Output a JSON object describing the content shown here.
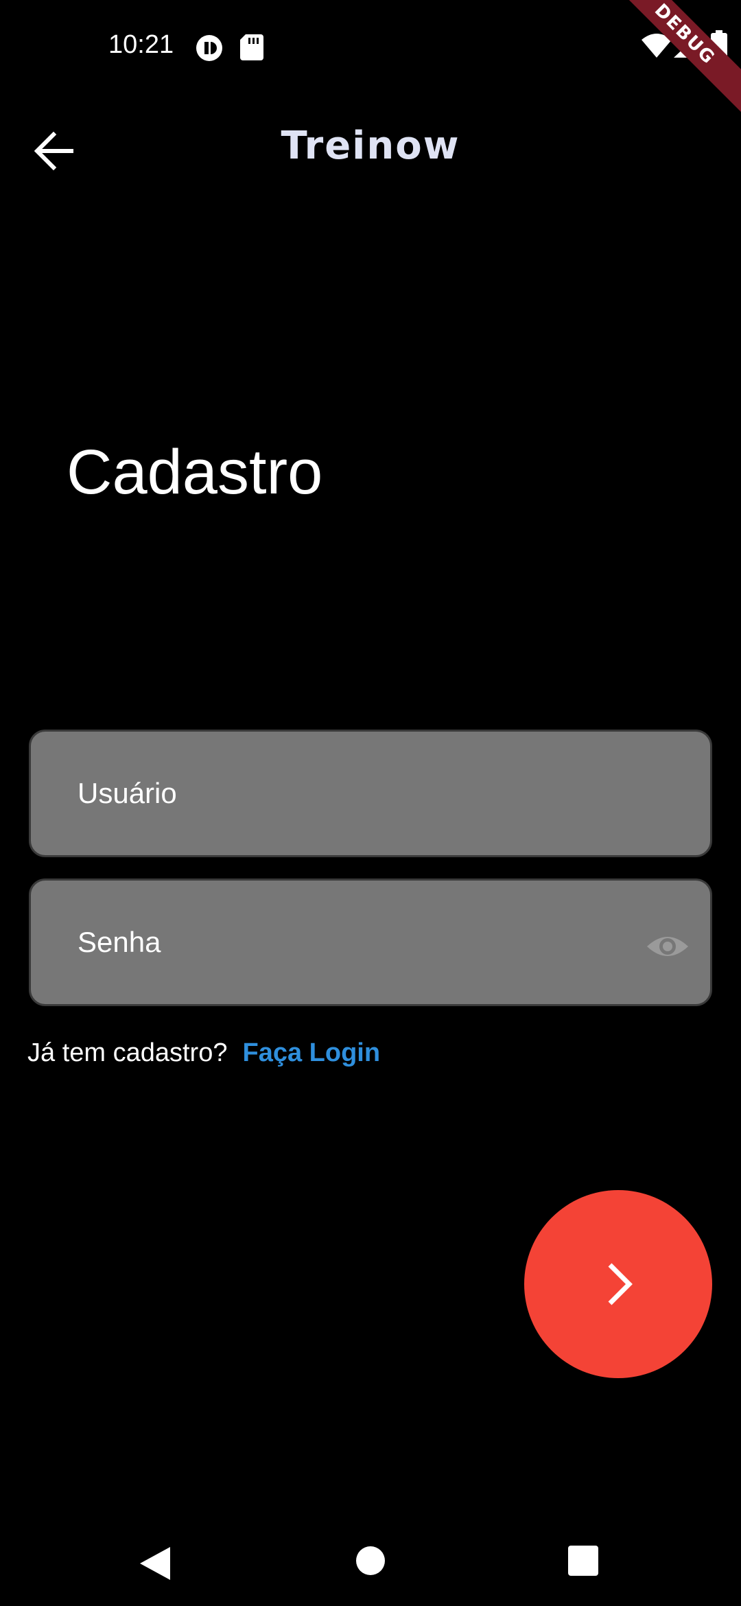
{
  "status_bar": {
    "time": "10:21",
    "debug_label": "DEBUG"
  },
  "app_bar": {
    "title": "Treinow"
  },
  "page": {
    "title": "Cadastro"
  },
  "form": {
    "username_placeholder": "Usuário",
    "password_placeholder": "Senha"
  },
  "login": {
    "prompt": "Já tem cadastro?",
    "link": "Faça Login"
  },
  "colors": {
    "background": "#000000",
    "field": "#777777",
    "link": "#2f8fdd",
    "fab": "#f44336"
  },
  "icons": {
    "back": "arrow-left-icon",
    "password_visibility": "eye-icon",
    "next": "chevron-right-icon"
  }
}
